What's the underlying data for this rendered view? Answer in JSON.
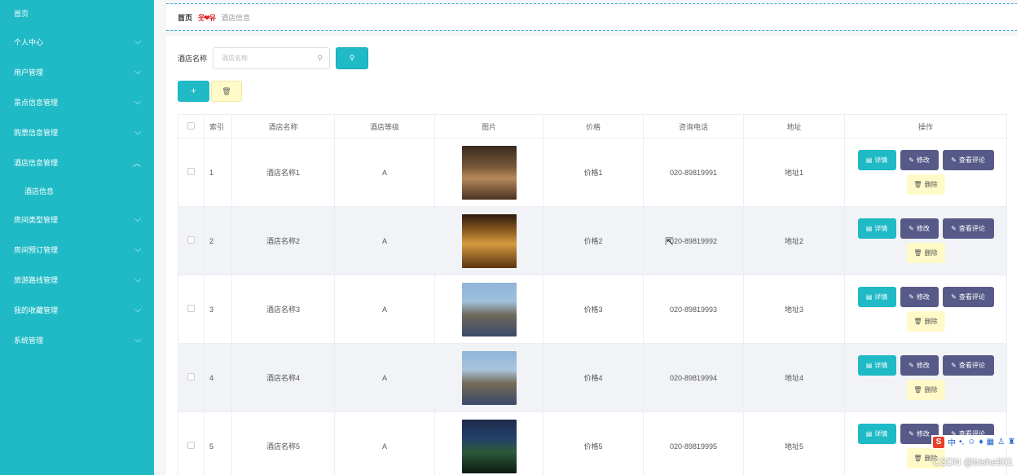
{
  "sidebar": {
    "items": [
      {
        "label": "首页",
        "chevron": ""
      },
      {
        "label": "个人中心",
        "chevron": "chevron-down"
      },
      {
        "label": "用户管理",
        "chevron": "chevron-down"
      },
      {
        "label": "景点信息管理",
        "chevron": "chevron-down"
      },
      {
        "label": "购票信息管理",
        "chevron": "chevron-down"
      },
      {
        "label": "酒店信息管理",
        "chevron": "chevron-up"
      }
    ],
    "sub_item": "酒店信息",
    "items_after": [
      {
        "label": "房间类型管理"
      },
      {
        "label": "房间预订管理"
      },
      {
        "label": "旅游路线管理"
      },
      {
        "label": "我的收藏管理"
      },
      {
        "label": "系统管理"
      }
    ],
    "background": "#1fbac6"
  },
  "breadcrumb": {
    "home": "首页",
    "separator": "웃❤유",
    "current": "酒店信息"
  },
  "search": {
    "label": "酒店名称",
    "placeholder": "酒店名称",
    "value": ""
  },
  "table": {
    "headers": [
      "",
      "索引",
      "酒店名称",
      "酒店等级",
      "图片",
      "价格",
      "咨询电话",
      "地址",
      "操作"
    ],
    "rows": [
      {
        "index": "1",
        "name": "酒店名称1",
        "level": "A",
        "price": "价格1",
        "phone": "020-89819991",
        "address": "地址1"
      },
      {
        "index": "2",
        "name": "酒店名称2",
        "level": "A",
        "price": "价格2",
        "phone": "020-89819992",
        "address": "地址2"
      },
      {
        "index": "3",
        "name": "酒店名称3",
        "level": "A",
        "price": "价格3",
        "phone": "020-89819993",
        "address": "地址3"
      },
      {
        "index": "4",
        "name": "酒店名称4",
        "level": "A",
        "price": "价格4",
        "phone": "020-89819994",
        "address": "地址4"
      },
      {
        "index": "5",
        "name": "酒店名称5",
        "level": "A",
        "price": "价格5",
        "phone": "020-89819995",
        "address": "地址5"
      }
    ],
    "ops": {
      "detail": "详情",
      "edit": "修改",
      "review": "查看评论",
      "delete": "删除"
    }
  },
  "ime": {
    "label": "中"
  },
  "watermark": "CSDN @bishe901",
  "colors": {
    "accent": "#1fbac6",
    "secondary": "#575a88",
    "warning_bg": "#fffac8"
  }
}
